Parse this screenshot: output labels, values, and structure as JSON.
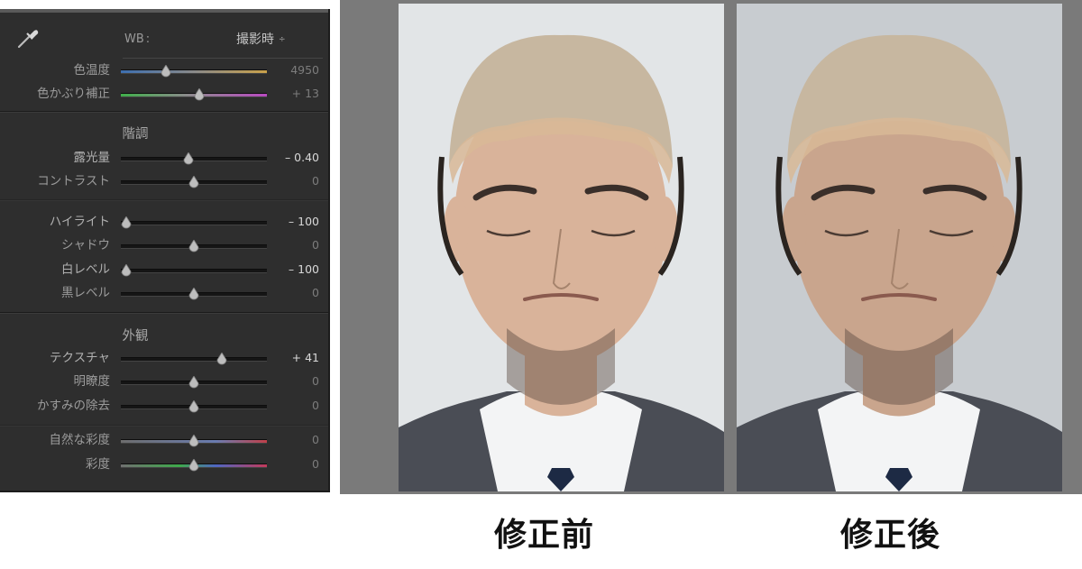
{
  "panel": {
    "wb_label": "WB",
    "wb_colon": ":",
    "wb_value": "撮影時",
    "wb_arrow": "÷",
    "rows": [
      {
        "id": "temp",
        "label": "色温度",
        "value": "4950",
        "position": 0.31,
        "active": false,
        "track": "temp"
      },
      {
        "id": "tint",
        "label": "色かぶり補正",
        "value": "+ 13",
        "position": 0.54,
        "active": false,
        "track": "tint"
      },
      {
        "id": "exposure",
        "label": "露光量",
        "value": "– 0.40",
        "position": 0.46,
        "active": true,
        "track": "plain"
      },
      {
        "id": "contrast",
        "label": "コントラスト",
        "value": "0",
        "position": 0.5,
        "active": false,
        "track": "plain"
      },
      {
        "id": "highlights",
        "label": "ハイライト",
        "value": "– 100",
        "position": 0.04,
        "active": true,
        "track": "plain"
      },
      {
        "id": "shadows",
        "label": "シャドウ",
        "value": "0",
        "position": 0.5,
        "active": false,
        "track": "plain"
      },
      {
        "id": "whites",
        "label": "白レベル",
        "value": "– 100",
        "position": 0.04,
        "active": true,
        "track": "plain"
      },
      {
        "id": "blacks",
        "label": "黒レベル",
        "value": "0",
        "position": 0.5,
        "active": false,
        "track": "plain"
      },
      {
        "id": "texture",
        "label": "テクスチャ",
        "value": "+ 41",
        "position": 0.69,
        "active": true,
        "track": "plain"
      },
      {
        "id": "clarity",
        "label": "明瞭度",
        "value": "0",
        "position": 0.5,
        "active": false,
        "track": "plain"
      },
      {
        "id": "dehaze",
        "label": "かすみの除去",
        "value": "0",
        "position": 0.5,
        "active": false,
        "track": "plain"
      },
      {
        "id": "vibrance",
        "label": "自然な彩度",
        "value": "0",
        "position": 0.5,
        "active": false,
        "track": "vib"
      },
      {
        "id": "saturation",
        "label": "彩度",
        "value": "0",
        "position": 0.5,
        "active": false,
        "track": "sat"
      }
    ],
    "sections": {
      "tone": "階調",
      "presence": "外観"
    },
    "icons": {
      "eyedropper": "eyedropper-icon"
    }
  },
  "compare": {
    "before_caption": "修正前",
    "after_caption": "修正後",
    "colors": {
      "before_bg": "#e2e5e7",
      "after_bg": "#c8ccd0",
      "skin_before": "#d9b39a",
      "skin_after": "#c9a58d",
      "cap": "#c7b7a0"
    }
  }
}
